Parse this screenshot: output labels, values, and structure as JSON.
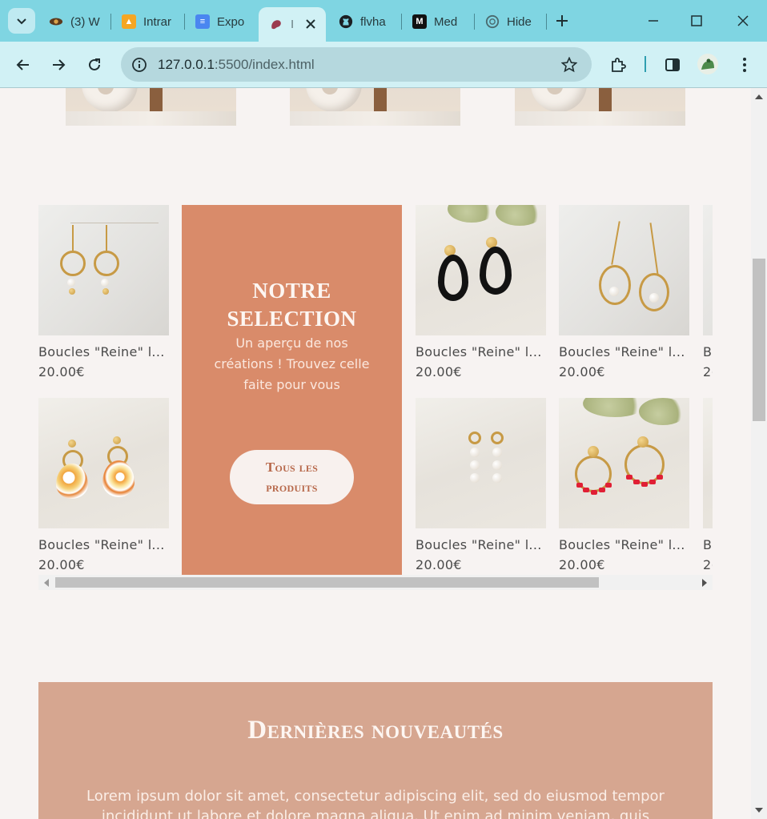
{
  "browser": {
    "tabs": [
      {
        "label": "(3) W",
        "icon": "eye-icon",
        "active": false
      },
      {
        "label": "Intrar",
        "icon": "intranet-icon",
        "active": false
      },
      {
        "label": "Expo",
        "icon": "docs-icon",
        "active": false
      },
      {
        "label": "I",
        "icon": "site-logo-icon",
        "active": true
      },
      {
        "label": "flvha",
        "icon": "github-icon",
        "active": false
      },
      {
        "label": "Med",
        "icon": "medium-icon",
        "active": false
      },
      {
        "label": "Hide",
        "icon": "openai-icon",
        "active": false
      }
    ],
    "url_host": "127.0.0.1",
    "url_path": ":5500/index.html"
  },
  "selection": {
    "title_line1": "NOTRE",
    "title_line2": "SELECTION",
    "subtitle": "Un aperçu de nos créations ! Trouvez celle faite pour vous",
    "button_line1": "Tous les",
    "button_line2": "produits"
  },
  "products": [
    {
      "name": "Boucles \"Reine\" l...",
      "price": "20.00€",
      "photo": "gold-hoop-charms"
    },
    {
      "name": "Boucles \"Reine\" l...",
      "price": "20.00€",
      "photo": "black-teardrop"
    },
    {
      "name": "Boucles \"Reine\" l...",
      "price": "20.00€",
      "photo": "gold-hoop-pearl"
    },
    {
      "name": "B",
      "price": "2(",
      "photo": "partial"
    },
    {
      "name": "Boucles \"Reine\" l...",
      "price": "20.00€",
      "photo": "floral-halfmoon"
    },
    {
      "name": "Boucles \"Reine\" l...",
      "price": "20.00€",
      "photo": "pearl-drop"
    },
    {
      "name": "Boucles \"Reine\" l...",
      "price": "20.00€",
      "photo": "red-beads-hoop"
    },
    {
      "name": "B",
      "price": "2(",
      "photo": "partial"
    }
  ],
  "news": {
    "heading": "Dernières nouveautés",
    "body": "Lorem ipsum dolor sit amet, consectetur adipiscing elit, sed do eiusmod tempor incididunt ut labore et dolore magna aliqua. Ut enim ad minim veniam, quis"
  },
  "colors": {
    "promo": "#d98b6a",
    "news": "#d6a690",
    "page_bg": "#f7f3f2",
    "tabstrip": "#7fd5e2"
  }
}
